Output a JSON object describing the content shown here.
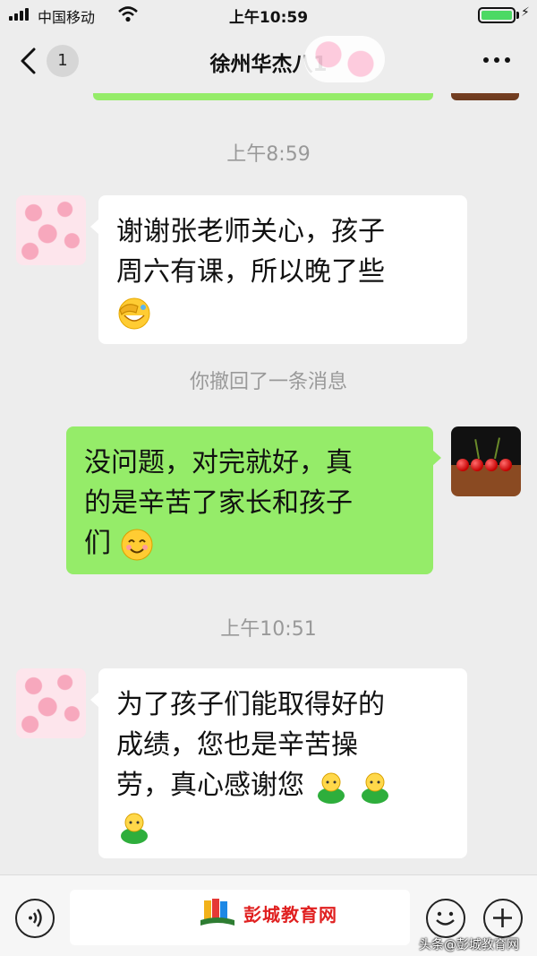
{
  "status_bar": {
    "carrier": "中国移动",
    "time": "上午10:59",
    "battery_level": 1.0
  },
  "nav": {
    "back_count": "1",
    "title": "徐州华杰八1"
  },
  "messages": [
    {
      "type": "timestamp",
      "text": "上午8:59"
    },
    {
      "type": "incoming",
      "lines": [
        "谢谢张老师关心，孩子",
        "周六有课，所以晚了些"
      ],
      "emoji": "face-with-hand-over-eyes-emoji"
    },
    {
      "type": "system",
      "text": "你撤回了一条消息"
    },
    {
      "type": "outgoing",
      "lines": [
        "没问题，对完就好，真",
        "的是辛苦了家长和孩子",
        "们"
      ],
      "emoji": "smile-emoji"
    },
    {
      "type": "timestamp",
      "text": "上午10:51"
    },
    {
      "type": "incoming",
      "lines": [
        "为了孩子们能取得好的",
        "成绩，您也是辛苦操",
        "劳，真心感谢您"
      ],
      "emoji": "bow-emoji"
    }
  ],
  "input_bar": {
    "logo_text": "彭城教育网"
  },
  "watermark": "头条@彭城教育网",
  "colors": {
    "outgoing_bubble": "#95ec69",
    "incoming_bubble": "#ffffff",
    "background": "#ededed",
    "logo": "#e02020"
  }
}
